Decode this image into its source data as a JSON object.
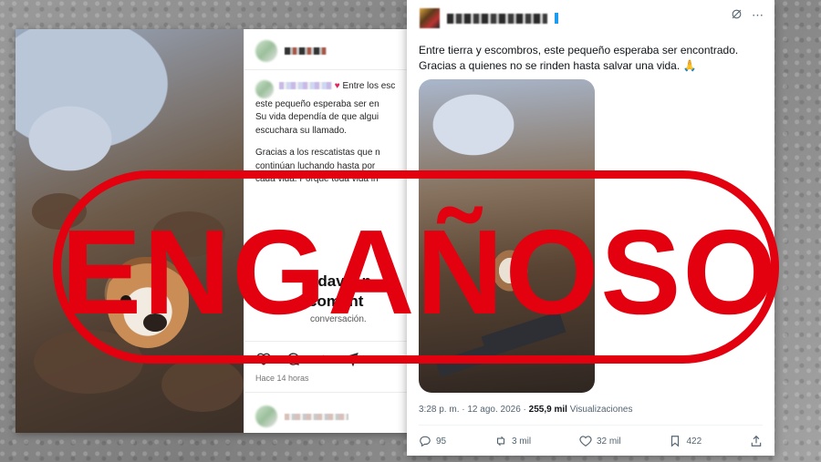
{
  "instagram_post": {
    "caption_line1": "Entre los esc",
    "caption_lines": [
      "este pequeño esperaba ser en",
      "Su vida dependía de que algui",
      "escuchara su llamado."
    ],
    "caption_para2": [
      "Gracias a los rescatistas que n",
      "continúan luchando hasta por",
      "cada vida. Porque toda vida in"
    ],
    "overlay_big_line1": "odavía n",
    "overlay_big_line2": "coment",
    "overlay_small": "conversación.",
    "time_ago": "Hace 14 horas",
    "icons": [
      "heart-icon",
      "comment-icon",
      "repost-icon",
      "share-icon"
    ]
  },
  "x_post": {
    "text_line1": "Entre tierra y escombros, este pequeño esperaba ser encontrado.",
    "text_line2": "Gracias a quienes no se rinden hasta salvar una vida. 🙏",
    "time": "3:28 p. m.",
    "date": "12 ago. 2026",
    "views_count": "255,9 mil",
    "views_label": "Visualizaciones",
    "separator": "·",
    "replies": "95",
    "reposts": "3 mil",
    "likes": "32 mil",
    "bookmarks": "422",
    "verified_color": "#1d9bf0"
  },
  "stamp": {
    "label": "ENGAÑOSO",
    "color": "#e3000f"
  }
}
